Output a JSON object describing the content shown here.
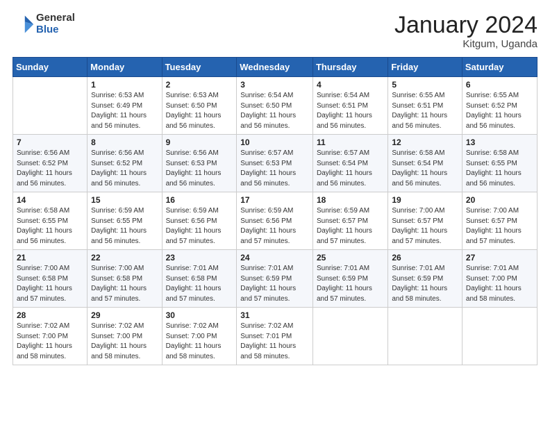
{
  "header": {
    "logo_general": "General",
    "logo_blue": "Blue",
    "month_title": "January 2024",
    "location": "Kitgum, Uganda"
  },
  "days_of_week": [
    "Sunday",
    "Monday",
    "Tuesday",
    "Wednesday",
    "Thursday",
    "Friday",
    "Saturday"
  ],
  "weeks": [
    [
      {
        "day": "",
        "info": ""
      },
      {
        "day": "1",
        "info": "Sunrise: 6:53 AM\nSunset: 6:49 PM\nDaylight: 11 hours\nand 56 minutes."
      },
      {
        "day": "2",
        "info": "Sunrise: 6:53 AM\nSunset: 6:50 PM\nDaylight: 11 hours\nand 56 minutes."
      },
      {
        "day": "3",
        "info": "Sunrise: 6:54 AM\nSunset: 6:50 PM\nDaylight: 11 hours\nand 56 minutes."
      },
      {
        "day": "4",
        "info": "Sunrise: 6:54 AM\nSunset: 6:51 PM\nDaylight: 11 hours\nand 56 minutes."
      },
      {
        "day": "5",
        "info": "Sunrise: 6:55 AM\nSunset: 6:51 PM\nDaylight: 11 hours\nand 56 minutes."
      },
      {
        "day": "6",
        "info": "Sunrise: 6:55 AM\nSunset: 6:52 PM\nDaylight: 11 hours\nand 56 minutes."
      }
    ],
    [
      {
        "day": "7",
        "info": ""
      },
      {
        "day": "8",
        "info": "Sunrise: 6:56 AM\nSunset: 6:52 PM\nDaylight: 11 hours\nand 56 minutes."
      },
      {
        "day": "9",
        "info": "Sunrise: 6:56 AM\nSunset: 6:53 PM\nDaylight: 11 hours\nand 56 minutes."
      },
      {
        "day": "10",
        "info": "Sunrise: 6:57 AM\nSunset: 6:53 PM\nDaylight: 11 hours\nand 56 minutes."
      },
      {
        "day": "11",
        "info": "Sunrise: 6:57 AM\nSunset: 6:54 PM\nDaylight: 11 hours\nand 56 minutes."
      },
      {
        "day": "12",
        "info": "Sunrise: 6:58 AM\nSunset: 6:54 PM\nDaylight: 11 hours\nand 56 minutes."
      },
      {
        "day": "13",
        "info": "Sunrise: 6:58 AM\nSunset: 6:55 PM\nDaylight: 11 hours\nand 56 minutes."
      }
    ],
    [
      {
        "day": "14",
        "info": ""
      },
      {
        "day": "15",
        "info": "Sunrise: 6:59 AM\nSunset: 6:55 PM\nDaylight: 11 hours\nand 56 minutes."
      },
      {
        "day": "16",
        "info": "Sunrise: 6:59 AM\nSunset: 6:56 PM\nDaylight: 11 hours\nand 57 minutes."
      },
      {
        "day": "17",
        "info": "Sunrise: 6:59 AM\nSunset: 6:56 PM\nDaylight: 11 hours\nand 57 minutes."
      },
      {
        "day": "18",
        "info": "Sunrise: 6:59 AM\nSunset: 6:57 PM\nDaylight: 11 hours\nand 57 minutes."
      },
      {
        "day": "19",
        "info": "Sunrise: 7:00 AM\nSunset: 6:57 PM\nDaylight: 11 hours\nand 57 minutes."
      },
      {
        "day": "20",
        "info": "Sunrise: 7:00 AM\nSunset: 6:57 PM\nDaylight: 11 hours\nand 57 minutes."
      }
    ],
    [
      {
        "day": "21",
        "info": ""
      },
      {
        "day": "22",
        "info": "Sunrise: 7:00 AM\nSunset: 6:58 PM\nDaylight: 11 hours\nand 57 minutes."
      },
      {
        "day": "23",
        "info": "Sunrise: 7:01 AM\nSunset: 6:58 PM\nDaylight: 11 hours\nand 57 minutes."
      },
      {
        "day": "24",
        "info": "Sunrise: 7:01 AM\nSunset: 6:59 PM\nDaylight: 11 hours\nand 57 minutes."
      },
      {
        "day": "25",
        "info": "Sunrise: 7:01 AM\nSunset: 6:59 PM\nDaylight: 11 hours\nand 57 minutes."
      },
      {
        "day": "26",
        "info": "Sunrise: 7:01 AM\nSunset: 6:59 PM\nDaylight: 11 hours\nand 58 minutes."
      },
      {
        "day": "27",
        "info": "Sunrise: 7:01 AM\nSunset: 7:00 PM\nDaylight: 11 hours\nand 58 minutes."
      }
    ],
    [
      {
        "day": "28",
        "info": "Sunrise: 7:02 AM\nSunset: 7:00 PM\nDaylight: 11 hours\nand 58 minutes."
      },
      {
        "day": "29",
        "info": "Sunrise: 7:02 AM\nSunset: 7:00 PM\nDaylight: 11 hours\nand 58 minutes."
      },
      {
        "day": "30",
        "info": "Sunrise: 7:02 AM\nSunset: 7:00 PM\nDaylight: 11 hours\nand 58 minutes."
      },
      {
        "day": "31",
        "info": "Sunrise: 7:02 AM\nSunset: 7:01 PM\nDaylight: 11 hours\nand 58 minutes."
      },
      {
        "day": "",
        "info": ""
      },
      {
        "day": "",
        "info": ""
      },
      {
        "day": "",
        "info": ""
      }
    ]
  ],
  "week1_day7_info": "Sunrise: 6:56 AM\nSunset: 6:52 PM\nDaylight: 11 hours\nand 56 minutes.",
  "week2_day14_info": "Sunrise: 6:58 AM\nSunset: 6:55 PM\nDaylight: 11 hours\nand 56 minutes.",
  "week3_day21_info": "Sunrise: 7:00 AM\nSunset: 6:58 PM\nDaylight: 11 hours\nand 57 minutes."
}
